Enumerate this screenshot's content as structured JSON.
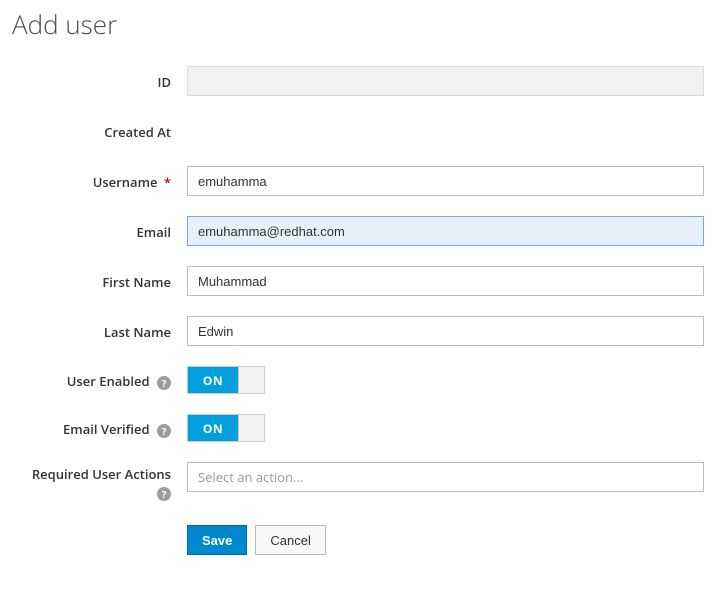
{
  "page": {
    "title": "Add user"
  },
  "labels": {
    "id": "ID",
    "created_at": "Created At",
    "username": "Username",
    "email": "Email",
    "first_name": "First Name",
    "last_name": "Last Name",
    "user_enabled": "User Enabled",
    "email_verified": "Email Verified",
    "required_actions": "Required User Actions"
  },
  "form": {
    "id": "",
    "created_at": "",
    "username": "emuhamma",
    "email": "emuhamma@redhat.com",
    "first_name": "Muhammad",
    "last_name": "Edwin",
    "user_enabled": "ON",
    "email_verified": "ON",
    "required_actions_placeholder": "Select an action..."
  },
  "buttons": {
    "save": "Save",
    "cancel": "Cancel"
  },
  "required_mark": "*",
  "help_glyph": "?"
}
